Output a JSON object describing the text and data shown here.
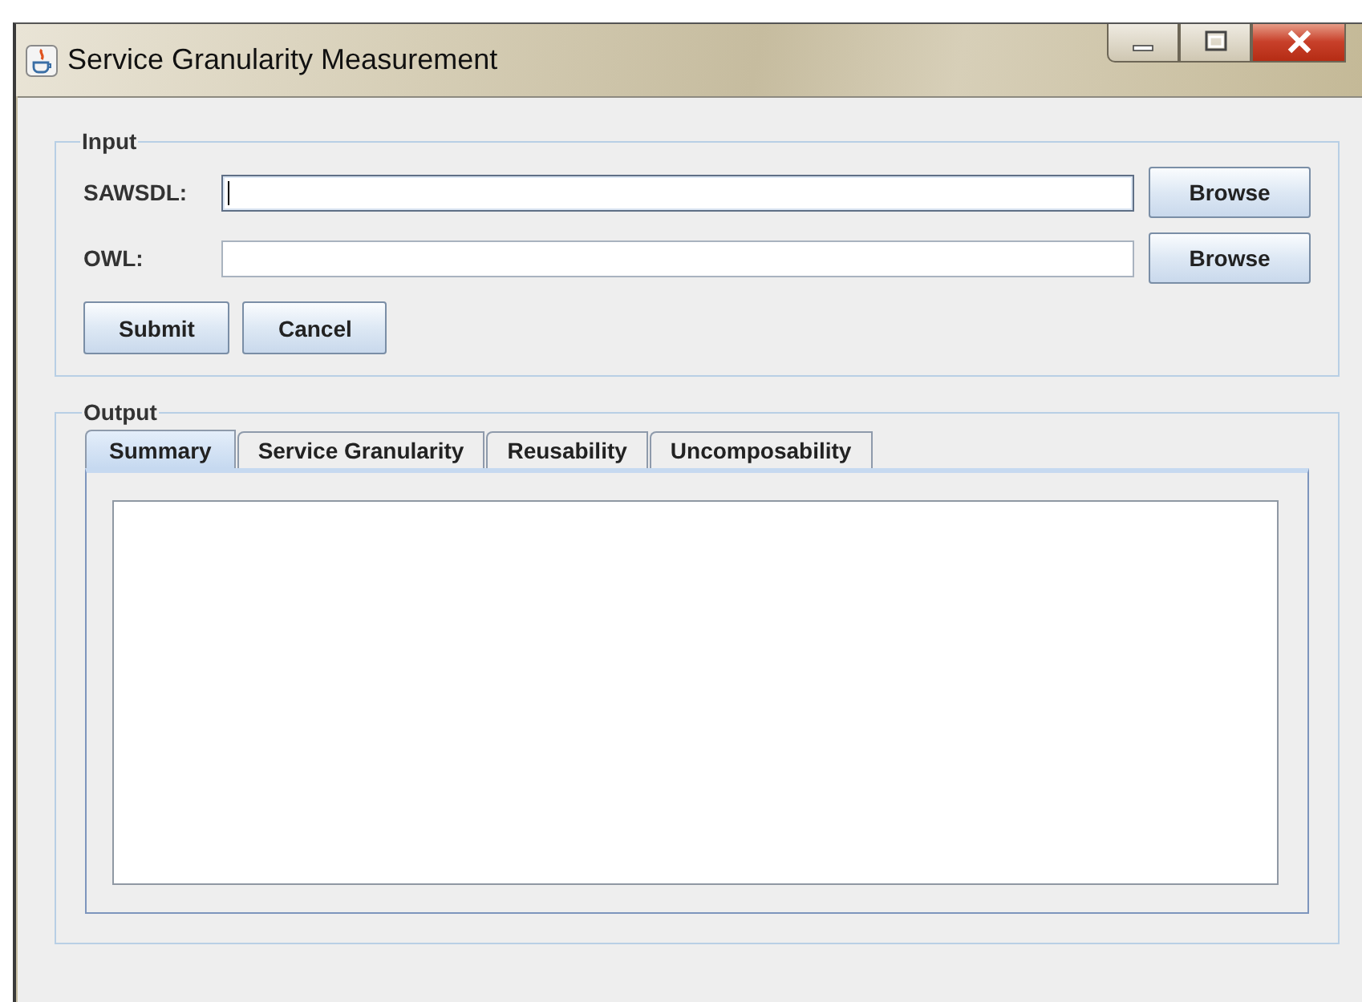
{
  "window": {
    "title": "Service Granularity Measurement"
  },
  "input": {
    "legend": "Input",
    "fields": [
      {
        "label": "SAWSDL:",
        "button": "Browse",
        "focused": true
      },
      {
        "label": "OWL:",
        "button": "Browse",
        "focused": false
      }
    ],
    "buttons": [
      "Submit",
      "Cancel"
    ]
  },
  "output": {
    "legend": "Output",
    "tabs": [
      {
        "label": "Summary",
        "selected": true
      },
      {
        "label": "Service Granularity",
        "selected": false
      },
      {
        "label": "Reusability",
        "selected": false
      },
      {
        "label": "Uncomposability",
        "selected": false
      }
    ]
  }
}
